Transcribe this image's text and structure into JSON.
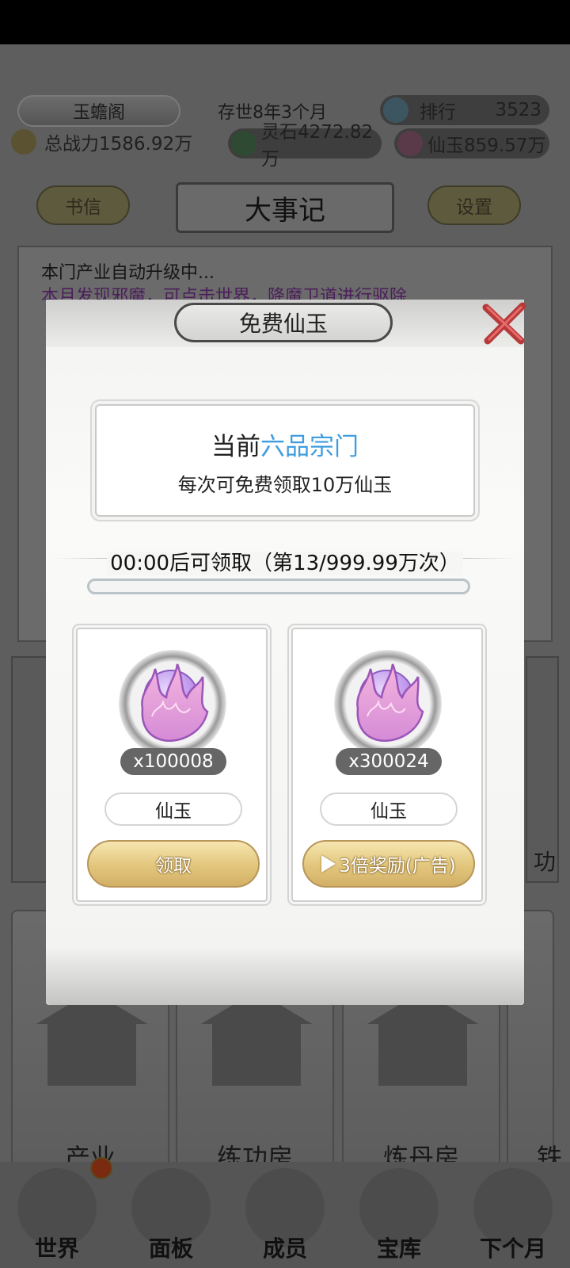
{
  "header": {
    "sect_name": "玉蟾阁",
    "time_label": "存世8年3个月",
    "rank_label": "排行",
    "rank_value": "3523",
    "power_label": "总战力1586.92万",
    "spirit_stone": "灵石4272.82万",
    "immortal_jade": "仙玉859.57万"
  },
  "nav": {
    "letters_button": "书信",
    "title": "大事记",
    "settings_button": "设置"
  },
  "log": {
    "line1": "本门产业自动升级中...",
    "line2": "本月发现邪魔，可点击世界，降魔卫道进行驱除"
  },
  "buildings": [
    "产业",
    "练功房",
    "炼丹房",
    "铁"
  ],
  "side_label": "功",
  "bottom_nav": [
    "世界",
    "面板",
    "成员",
    "宝库",
    "下个月"
  ],
  "modal": {
    "title": "免费仙玉",
    "current_prefix": "当前",
    "current_rank": "六品宗门",
    "per_claim": "每次可免费领取10万仙玉",
    "timer": "00:00后可领取（第13/999.99万次）",
    "progress": 0,
    "cards": [
      {
        "quantity": "x100008",
        "name": "仙玉",
        "button": "领取"
      },
      {
        "quantity": "x300024",
        "name": "仙玉",
        "button": "3倍奖励(广告)"
      }
    ]
  },
  "colors": {
    "highlight": "#3f9de0",
    "button_gold": "#e2c67c",
    "orb_purple": "#c9a6f0"
  }
}
